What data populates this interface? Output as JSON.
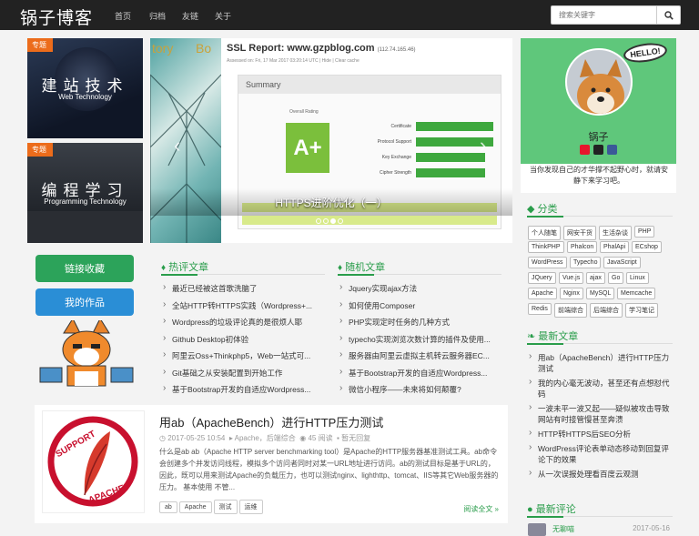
{
  "navbar": {
    "brand": "锅子博客",
    "links": [
      "首页",
      "归档",
      "友链",
      "关于"
    ],
    "search_placeholder": "搜索关键字"
  },
  "tiles": [
    {
      "tag": "专题",
      "title": "建站技术",
      "subtitle": "Web Technology"
    },
    {
      "tag": "专题",
      "title": "编程学习",
      "subtitle": "Programming Technology"
    }
  ],
  "carousel": {
    "caption": "HTTPS进阶优化（一）",
    "ssl_title": "SSL Report: www.gzpblog.com",
    "ssl_ip": "(112.74.165.46)",
    "ssl_assessed": "Assessed on: Fri, 17 Mar 2017 03:20:14 UTC | Hide | Clear cache",
    "summary": "Summary",
    "overall": "Overall Rating",
    "grade": "A+",
    "bar_labels": [
      "Certificate",
      "Protocol Support",
      "Key Exchange",
      "Cipher Strength"
    ]
  },
  "profile": {
    "name": "锅子",
    "motto": "当你发现自己的才华撑不起野心时，就请安静下来学习吧。",
    "hello": "HELLO!"
  },
  "side_buttons": [
    "链接收藏",
    "我的作品"
  ],
  "hot": {
    "heading": "热评文章",
    "items": [
      "最近已经被这首歌洗脑了",
      "全站HTTP转HTTPS实践（Wordpress+...",
      "Wordpress的垃圾评论真的是很烦人耶",
      "Github Desktop初体验",
      "阿里云Oss+Thinkphp5，Web一站式可...",
      "Git基础之从安装配置到开始工作",
      "基于Bootstrap开发的自适应Wordpress..."
    ]
  },
  "random": {
    "heading": "随机文章",
    "items": [
      "Jquery实现ajax方法",
      "如何使用Composer",
      "PHP实现定时任务的几种方式",
      "typecho实现浏览次数计算的插件及使用...",
      "服务器由阿里云虚拟主机转云服务器EC...",
      "基于Bootstrap开发的自适应Wordpress...",
      "微信小程序——未来将如何颠覆?"
    ]
  },
  "categories": {
    "heading": "分类",
    "rows": [
      [
        "个人随笔",
        "网安干货",
        "生活杂谈",
        "PHP"
      ],
      [
        "ThinkPHP",
        "Phalcon",
        "PhalApi",
        "ECshop"
      ],
      [
        "WordPress",
        "Typecho",
        "JavaScript"
      ],
      [
        "JQuery",
        "Vue.js",
        "ajax",
        "Go",
        "Linux"
      ],
      [
        "Apache",
        "Nginx",
        "MySQL",
        "Memcache"
      ],
      [
        "Redis",
        "前端综合",
        "后端综合",
        "学习笔记"
      ]
    ]
  },
  "latest": {
    "heading": "最新文章",
    "items": [
      "用ab（ApacheBench）进行HTTP压力测试",
      "我的内心毫无波动，甚至还有点想怼代码",
      "一波未平一波又起——疑似被攻击导致网站有时接管慢甚至奔溃",
      "HTTP转HTTPS后SEO分析",
      "WordPress评论表单动态移动到回复评论下的效果",
      "从一次误报处理看百度云观测"
    ]
  },
  "recent_comments": {
    "heading": "最新评论",
    "author": "无聊喵",
    "date": "2017-05-16"
  },
  "post": {
    "title": "用ab（ApacheBench）进行HTTP压力测试",
    "date": "2017-05-25 10:54",
    "category": "Apache，后端综合",
    "views": "45 阅读",
    "comments": "暂无回复",
    "excerpt": "什么是ab ab（Apache HTTP server benchmarking tool）是Apache的HTTP服务器基准测试工具。ab命令会创建多个并发访问线程，模拟多个访问者同时对某一URL地址进行访问。ab的测试目标是基于URL的，因此，既可以用来测试Apache的负载压力，也可以测试nginx、lighthttp、tomcat、IIS等其它Web服务器的压力。 基本使用 不管...",
    "tags": [
      "ab",
      "Apache",
      "测试",
      "运维"
    ],
    "read_more": "阅读全文 »",
    "thumb_top": "SUPPORT",
    "thumb_bottom": "APACHE"
  },
  "colors": {
    "accent": "#2a9d4b",
    "tag_orange": "#ec6c1b",
    "nav_bg": "#222222"
  }
}
